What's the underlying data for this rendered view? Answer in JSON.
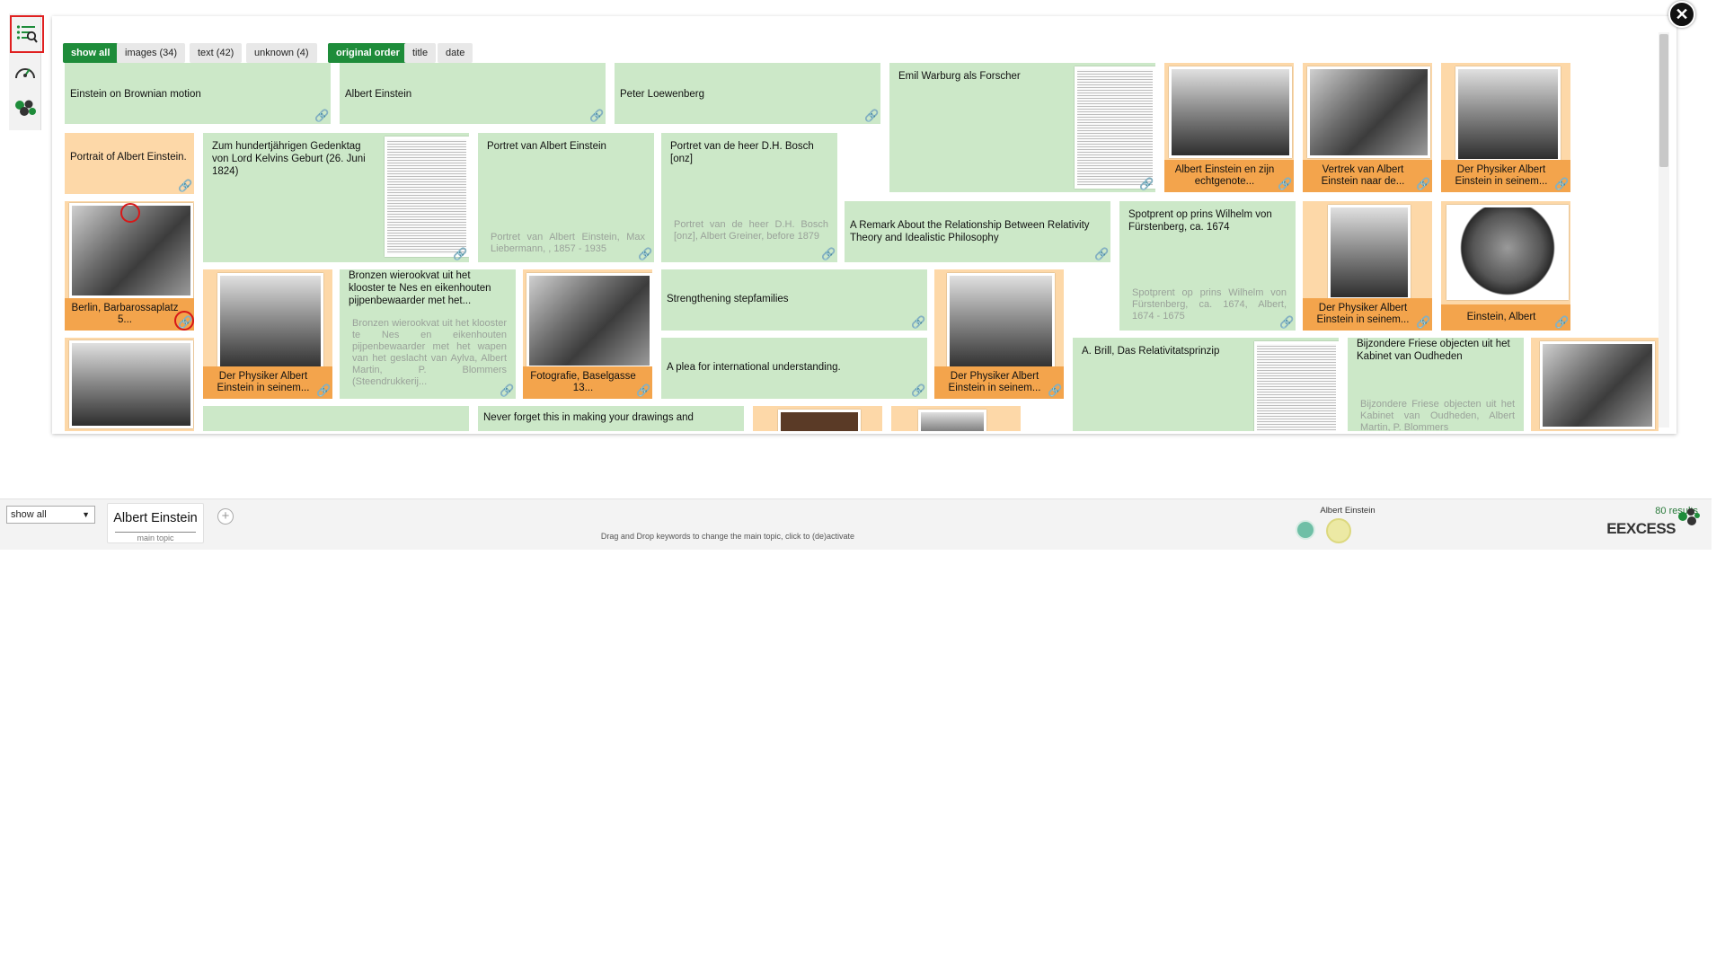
{
  "filters": {
    "show_all": "show all",
    "images": "images (34)",
    "text": "text (42)",
    "unknown": "unknown (4)",
    "original_order": "original order",
    "title": "title",
    "date": "date"
  },
  "cards": [
    {
      "title": "Einstein on Brownian motion"
    },
    {
      "title": "Albert Einstein"
    },
    {
      "title": "Peter Loewenberg"
    },
    {
      "title": "Emil Warburg als Forscher"
    },
    {
      "title": "Albert Einstein en zijn echtgenote..."
    },
    {
      "title": "Vertrek van Albert Einstein naar de..."
    },
    {
      "title": "Der Physiker Albert Einstein in seinem..."
    },
    {
      "title": "Portrait of Albert Einstein."
    },
    {
      "title": "Zum hundertjährigen Gedenktag von Lord Kelvins Geburt (26. Juni 1824)"
    },
    {
      "title": "Portret van Albert Einstein",
      "desc": "Portret van Albert Einstein, Max Liebermann, , 1857 - 1935"
    },
    {
      "title": "Portret van de heer D.H. Bosch [onz]",
      "desc": "Portret van de heer D.H. Bosch [onz], Albert Greiner, before 1879"
    },
    {
      "title": "A Remark About the Relationship Between Relativity Theory and Idealistic Philosophy"
    },
    {
      "title": "Spotprent op prins Wilhelm von Fürstenberg, ca. 1674",
      "desc": "Spotprent op prins Wilhelm von Fürstenberg, ca. 1674, Albert, 1674 - 1675"
    },
    {
      "title": "Der Physiker Albert Einstein in seinem..."
    },
    {
      "title": "Einstein, Albert"
    },
    {
      "title": "Berlin, Barbarossaplatz 5..."
    },
    {
      "title": "Der Physiker Albert Einstein in seinem..."
    },
    {
      "title": "Bronzen wierookvat uit het klooster te Nes en eikenhouten pijpenbewaarder met het...",
      "desc": "Bronzen wierookvat uit het klooster te Nes en eikenhouten pijpenbewaarder met het wapen van het geslacht van Aylva, Albert Martin, P. Blommers (Steendrukkerij..."
    },
    {
      "title": "Fotografie, Baselgasse 13..."
    },
    {
      "title": "Strengthening stepfamilies"
    },
    {
      "title": "A plea for international understanding."
    },
    {
      "title": "Der Physiker Albert Einstein in seinem..."
    },
    {
      "title": "A. Brill, Das Relativitatsprinzip"
    },
    {
      "title": "Bijzondere Friese objecten uit het Kabinet van Oudheden",
      "desc": "Bijzondere Friese objecten uit het Kabinet van Oudheden, Albert Martin, P. Blommers"
    },
    {
      "title": "Never forget this in making your drawings and"
    }
  ],
  "bottom": {
    "select_value": "show all",
    "keyword": "Albert Einstein",
    "keyword_sub": "main topic",
    "add_symbol": "+",
    "hint": "Drag and Drop keywords to change the main topic, click to (de)activate",
    "legend_label": "Albert Einstein",
    "results": "80 results",
    "brand": "EEXCESS"
  },
  "icons": {
    "close": "close-icon",
    "link": "link-icon",
    "list_search": "list-search-icon",
    "dashboard": "speedometer-icon",
    "clusters": "cluster-icon"
  },
  "colors": {
    "accent_green": "#1e8c3a",
    "text_card": "#cce8c8",
    "image_card": "#fdd8a8",
    "image_caption": "#f3a44c",
    "highlight_red": "#d71818"
  }
}
